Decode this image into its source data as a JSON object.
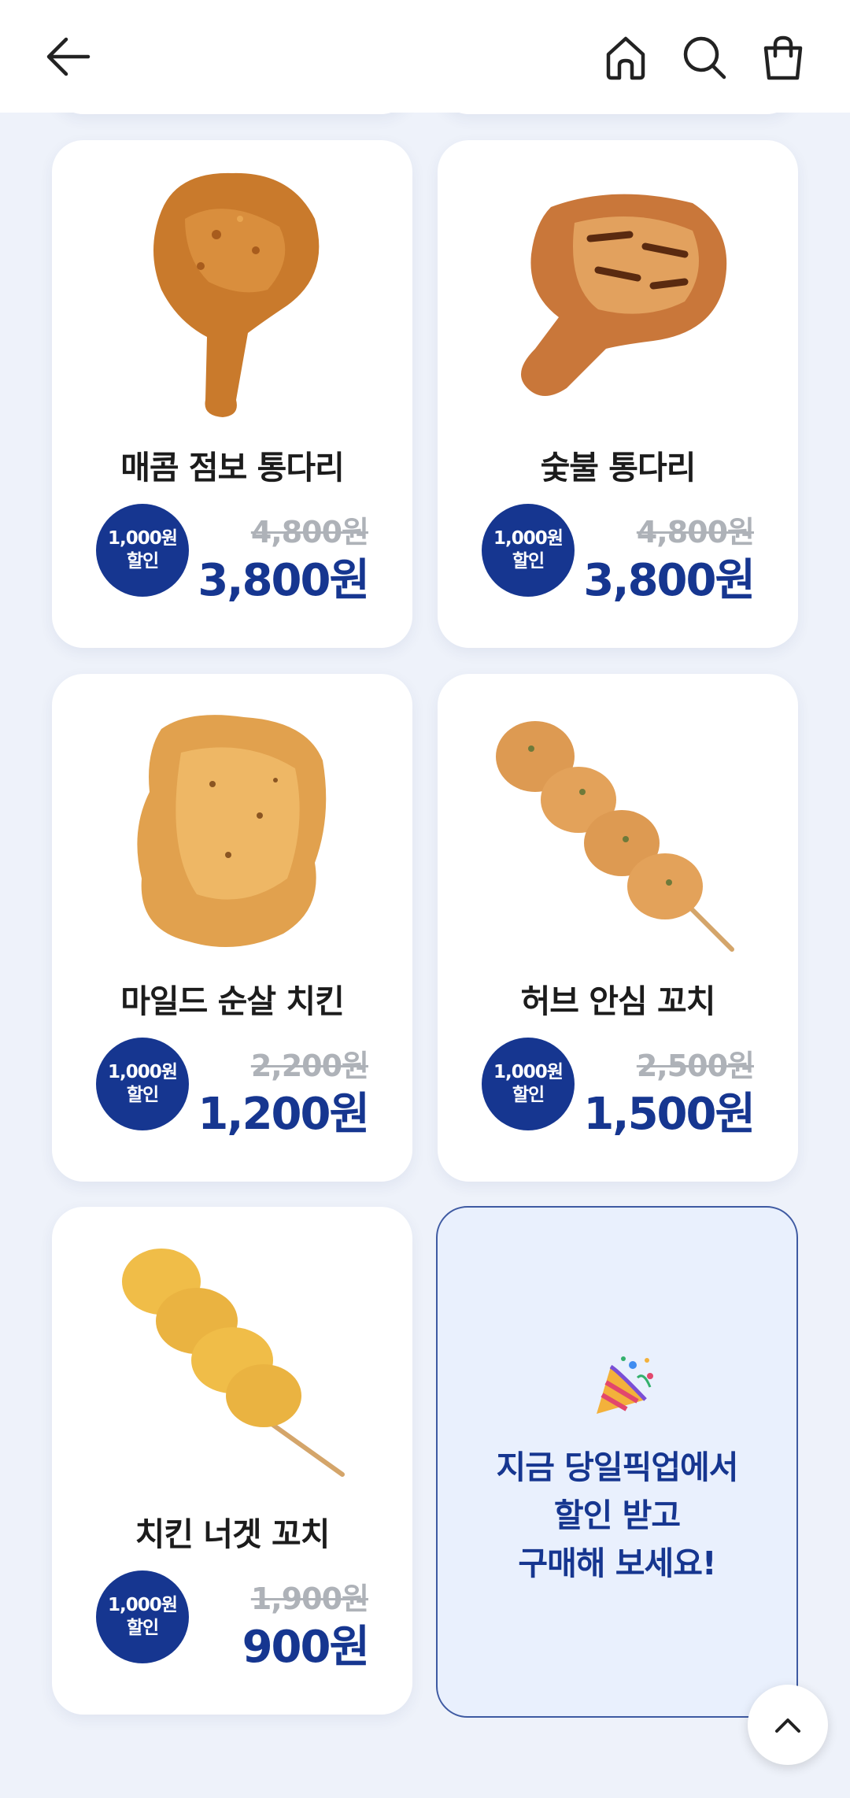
{
  "header": {
    "back_icon": "arrow-left-icon",
    "home_icon": "home-icon",
    "search_icon": "search-icon",
    "cart_icon": "shopping-bag-icon"
  },
  "products": [
    {
      "name": "매콤 점보 통다리",
      "badge_line1": "1,000원",
      "badge_line2": "할인",
      "original_price": "4,800원",
      "sale_price": "3,800원"
    },
    {
      "name": "숯불 통다리",
      "badge_line1": "1,000원",
      "badge_line2": "할인",
      "original_price": "4,800원",
      "sale_price": "3,800원"
    },
    {
      "name": "마일드 순살 치킨",
      "badge_line1": "1,000원",
      "badge_line2": "할인",
      "original_price": "2,200원",
      "sale_price": "1,200원"
    },
    {
      "name": "허브 안심 꼬치",
      "badge_line1": "1,000원",
      "badge_line2": "할인",
      "original_price": "2,500원",
      "sale_price": "1,500원"
    },
    {
      "name": "치킨 너겟 꼬치",
      "badge_line1": "1,000원",
      "badge_line2": "할인",
      "original_price": "1,900원",
      "sale_price": "900원"
    }
  ],
  "promo": {
    "icon": "party-popper-icon",
    "line1": "지금 당일픽업에서",
    "line2": "할인 받고",
    "line3": "구매해 보세요!"
  },
  "scroll_top_icon": "chevron-up-icon",
  "colors": {
    "accent": "#163690",
    "background": "#eef2fa",
    "promo_background": "#e9f0fd",
    "strike_price": "#aeb2b8"
  }
}
